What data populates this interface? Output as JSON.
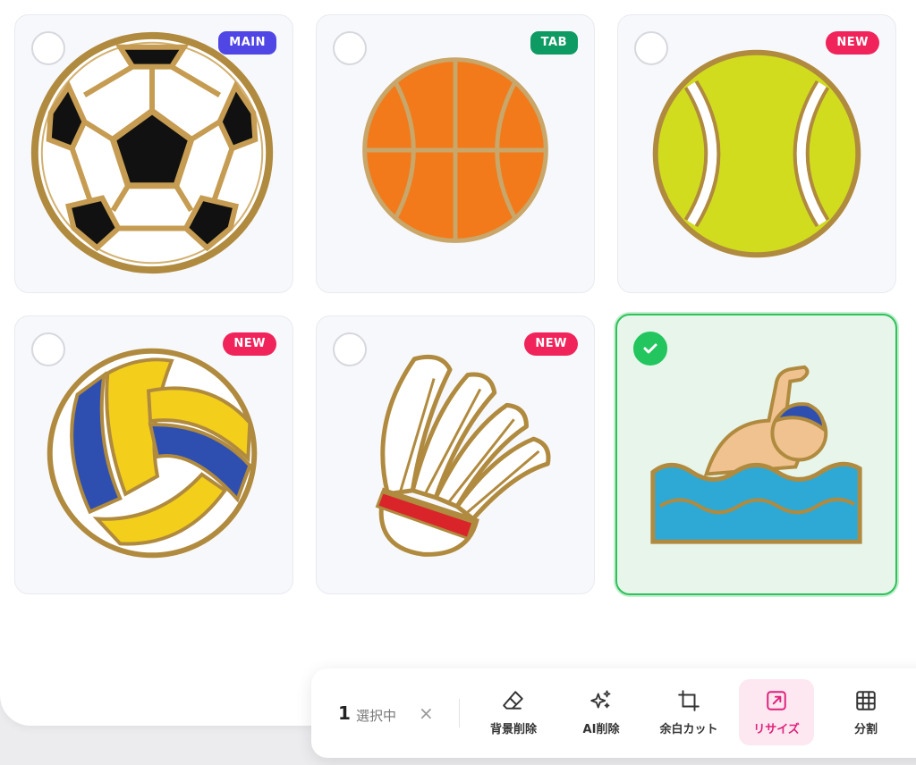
{
  "cards": [
    {
      "name": "soccer-ball",
      "badge": "MAIN",
      "badge_color": "#4f46e5",
      "selected": false
    },
    {
      "name": "basketball",
      "badge": "TAB",
      "badge_color": "#0e9a63",
      "selected": false
    },
    {
      "name": "tennis-ball",
      "badge": "NEW",
      "badge_color": "#f0245a",
      "selected": false
    },
    {
      "name": "volleyball",
      "badge": "NEW",
      "badge_color": "#f0245a",
      "selected": false
    },
    {
      "name": "shuttlecock",
      "badge": "NEW",
      "badge_color": "#f0245a",
      "selected": false
    },
    {
      "name": "swimmer",
      "badge": "",
      "badge_color": "#22c55e",
      "selected": true
    }
  ],
  "toolbar": {
    "count": "1",
    "count_label": "選択中",
    "clear_label": "×",
    "tools": [
      {
        "label": "背景削除",
        "icon": "eraser-icon"
      },
      {
        "label": "AI削除",
        "icon": "sparkles-icon"
      },
      {
        "label": "余白カット",
        "icon": "crop-icon"
      },
      {
        "label": "リサイズ",
        "icon": "resize-icon",
        "active": true
      },
      {
        "label": "分割",
        "icon": "grid-icon"
      }
    ]
  },
  "colors": {
    "accent": "#e0217a",
    "selected_border": "#2ec25a",
    "gold": "#b08a3e"
  }
}
